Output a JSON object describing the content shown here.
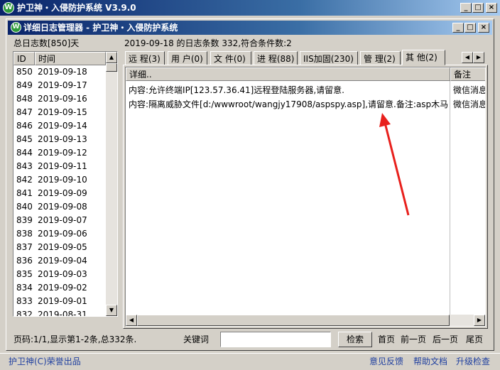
{
  "outer_window": {
    "title": "护卫神・入侵防护系统 V3.9.0",
    "buttons": {
      "minimize": "_",
      "maximize": "□",
      "close": "×"
    }
  },
  "inner_window": {
    "title": "详细日志管理器 - 护卫神・入侵防护系统",
    "buttons": {
      "minimize": "_",
      "maximize": "□",
      "close": "×"
    }
  },
  "left_panel": {
    "total_label": "总日志数[850]天",
    "columns": [
      "ID",
      "时间"
    ],
    "rows": [
      {
        "id": "850",
        "date": "2019-09-18"
      },
      {
        "id": "849",
        "date": "2019-09-17"
      },
      {
        "id": "848",
        "date": "2019-09-16"
      },
      {
        "id": "847",
        "date": "2019-09-15"
      },
      {
        "id": "846",
        "date": "2019-09-14"
      },
      {
        "id": "845",
        "date": "2019-09-13"
      },
      {
        "id": "844",
        "date": "2019-09-12"
      },
      {
        "id": "843",
        "date": "2019-09-11"
      },
      {
        "id": "842",
        "date": "2019-09-10"
      },
      {
        "id": "841",
        "date": "2019-09-09"
      },
      {
        "id": "840",
        "date": "2019-09-08"
      },
      {
        "id": "839",
        "date": "2019-09-07"
      },
      {
        "id": "838",
        "date": "2019-09-06"
      },
      {
        "id": "837",
        "date": "2019-09-05"
      },
      {
        "id": "836",
        "date": "2019-09-04"
      },
      {
        "id": "835",
        "date": "2019-09-03"
      },
      {
        "id": "834",
        "date": "2019-09-02"
      },
      {
        "id": "833",
        "date": "2019-09-01"
      },
      {
        "id": "832",
        "date": "2019-08-31"
      }
    ]
  },
  "right_panel": {
    "summary": "2019-09-18 的日志条数 332,符合条件数:2",
    "tabs": [
      {
        "label": "远 程(3)"
      },
      {
        "label": "用 户(0)"
      },
      {
        "label": "文 件(0)"
      },
      {
        "label": "进 程(88)"
      },
      {
        "label": "IIS加固(230)"
      },
      {
        "label": "管 理(2)"
      },
      {
        "label": "其 他(2)"
      }
    ],
    "columns": [
      "详细..",
      "备注"
    ],
    "rows": [
      {
        "detail": "内容:允许终端IP[123.57.36.41]远程登陆服务器,请留意.",
        "note": "微信消息"
      },
      {
        "detail": "内容:隔离威胁文件[d:/wwwroot/wangjy17908/aspspy.asp],请留意.备注:asp木马.",
        "note": "微信消息"
      }
    ]
  },
  "footer": {
    "page_info": "页码:1/1,显示第1-2条,总332条.",
    "keyword_label": "关键词",
    "keyword_value": "",
    "search_button": "检索",
    "first_page": "首页",
    "prev_page": "前一页",
    "next_page": "后一页",
    "last_page": "尾页"
  },
  "status_bar": {
    "copyright": "护卫神(C)荣誉出品",
    "feedback": "意见反馈",
    "help": "帮助文档",
    "upgrade": "升级检查"
  },
  "annotation": {
    "arrow_color": "#e8201c"
  },
  "colors": {
    "title_start": "#0a246a",
    "title_end": "#a6caf0",
    "face": "#d4d0c8",
    "link_blue": "#1f3f9f"
  }
}
